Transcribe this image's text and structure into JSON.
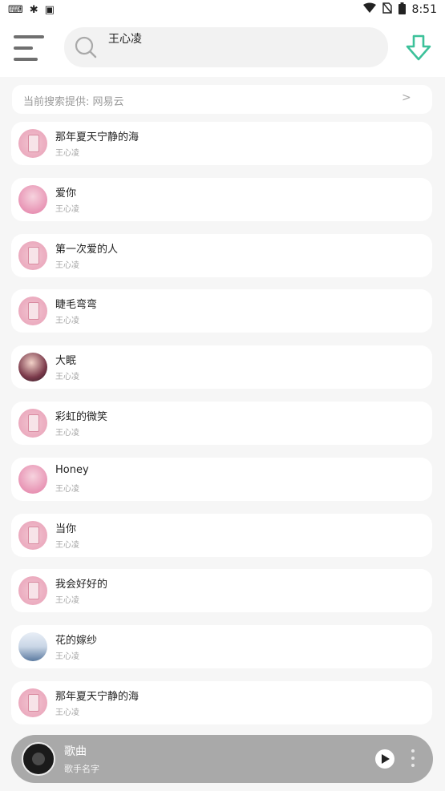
{
  "status_bar": {
    "left_icons": [
      "keyboard-icon",
      "bug-icon",
      "a-badge-icon"
    ],
    "right_icons": [
      "wifi-icon",
      "no-sim-icon",
      "battery-icon"
    ],
    "time": "8:51"
  },
  "header": {
    "search_value": "王心凌",
    "accent_color": "#3cc19a"
  },
  "source_bar": {
    "label": "当前搜索提供: 网易云",
    "arrow": ">"
  },
  "songs": [
    {
      "title": "那年夏天宁静的海",
      "artist": "王心凌",
      "cover": "pink-card"
    },
    {
      "title": "爱你",
      "artist": "王心凌",
      "cover": "pink-group"
    },
    {
      "title": "第一次爱的人",
      "artist": "王心凌",
      "cover": "pink-card"
    },
    {
      "title": "睫毛弯弯",
      "artist": "王心凌",
      "cover": "pink-card"
    },
    {
      "title": "大眠",
      "artist": "王心凌",
      "cover": "portrait"
    },
    {
      "title": "彩虹的微笑",
      "artist": "王心凌",
      "cover": "pink-card"
    },
    {
      "title": "Honey",
      "artist": "王心凌",
      "cover": "pink-group"
    },
    {
      "title": "当你",
      "artist": "王心凌",
      "cover": "pink-card"
    },
    {
      "title": "我会好好的",
      "artist": "王心凌",
      "cover": "pink-card"
    },
    {
      "title": "花的嫁纱",
      "artist": "王心凌",
      "cover": "group-photo"
    },
    {
      "title": "那年夏天宁静的海",
      "artist": "王心凌",
      "cover": "pink-card"
    }
  ],
  "player": {
    "title": "歌曲",
    "artist": "歌手名字",
    "disc_icon": "music-disc-icon",
    "play_icon": "play-icon",
    "more_icon": "more-vertical-icon"
  }
}
